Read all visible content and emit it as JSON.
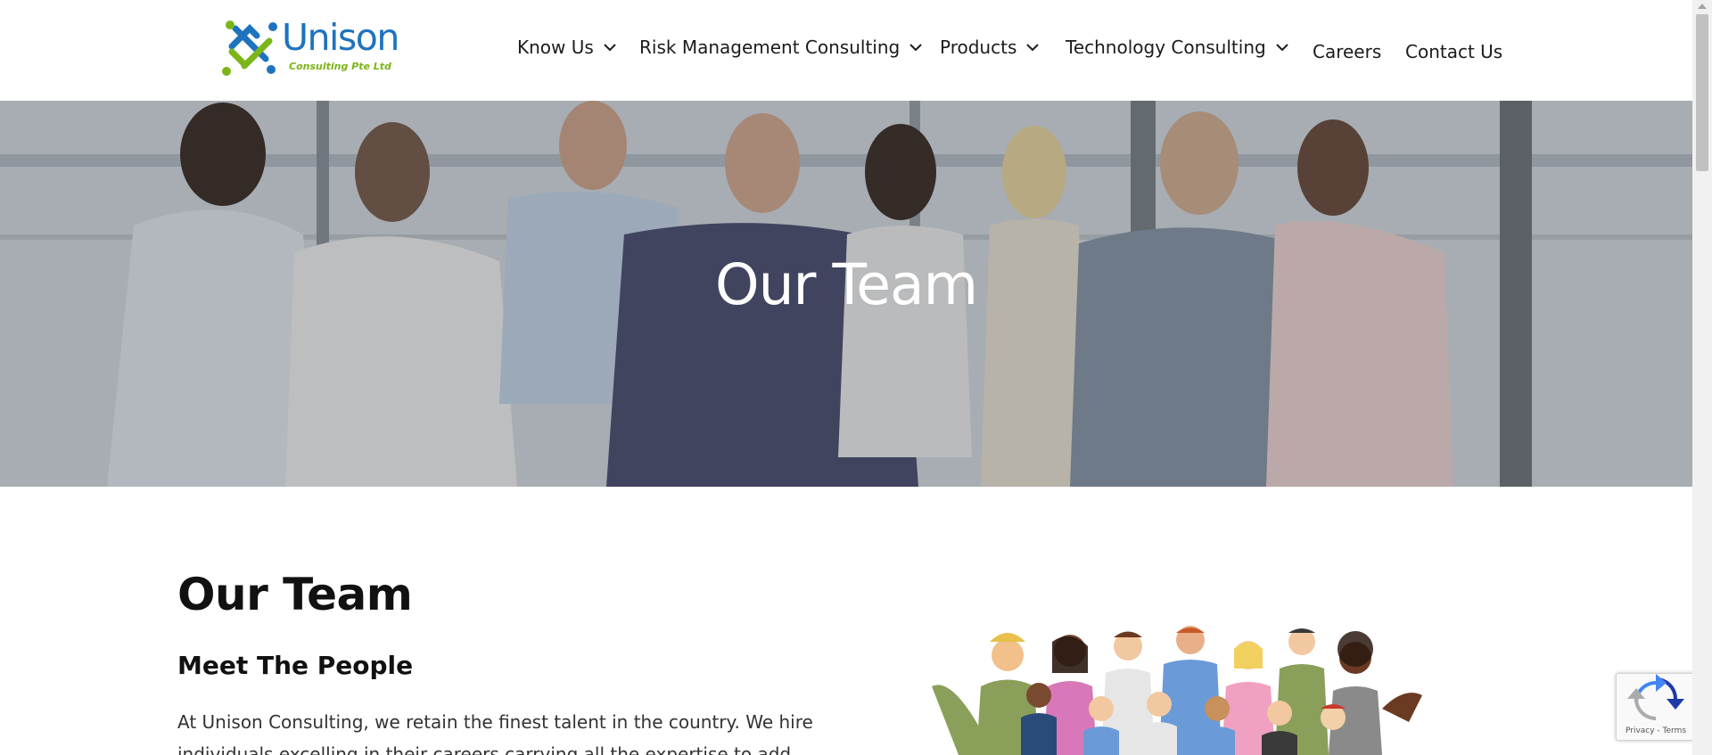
{
  "brand": {
    "name": "Unison",
    "tagline": "Consulting Pte Ltd",
    "colors": {
      "blue": "#1e73be",
      "green": "#7cb518"
    }
  },
  "nav": {
    "items": [
      {
        "label": "Know Us",
        "has_dropdown": true
      },
      {
        "label": "Risk Management Consulting",
        "has_dropdown": true
      },
      {
        "label": "Products",
        "has_dropdown": true
      },
      {
        "label": "Technology Consulting",
        "has_dropdown": true
      },
      {
        "label": "Careers",
        "has_dropdown": false
      },
      {
        "label": "Contact Us",
        "has_dropdown": false
      }
    ]
  },
  "hero": {
    "title": "Our Team"
  },
  "content": {
    "title": "Our Team",
    "subtitle": "Meet The People",
    "body": "At Unison Consulting, we retain the finest talent in the country. We hire individuals excelling in their careers carrying all the expertise to add"
  },
  "recaptcha": {
    "links": "Privacy - Terms"
  }
}
